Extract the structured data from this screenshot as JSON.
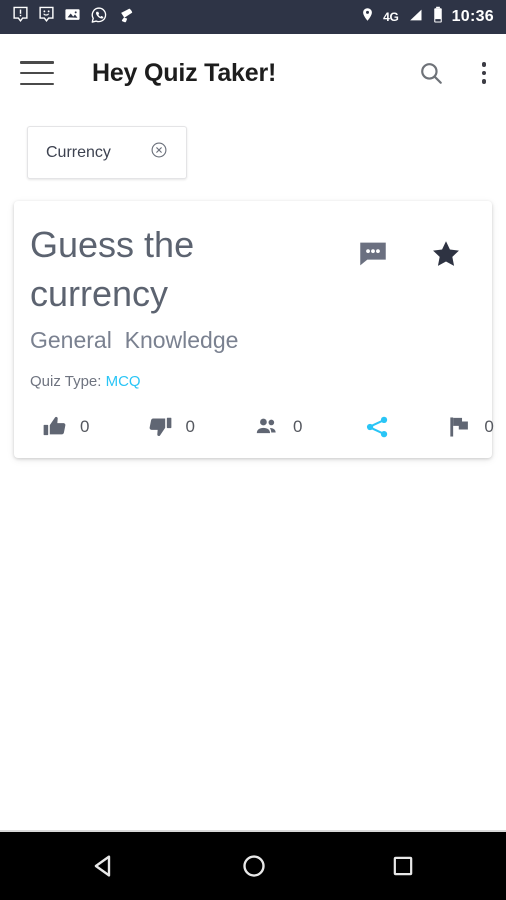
{
  "statusbar": {
    "notifications": [
      {
        "name": "alert-notification-icon"
      },
      {
        "name": "smiley-notification-icon"
      },
      {
        "name": "photo-notification-icon"
      },
      {
        "name": "whatsapp-notification-icon"
      },
      {
        "name": "cleaner-notification-icon"
      }
    ],
    "location_icon": "location-pin-icon",
    "network": "4G",
    "signal_icon": "signal-bars-icon",
    "battery_icon": "battery-icon",
    "time": "10:36",
    "background": "#2e3446"
  },
  "appbar": {
    "menu_icon": "hamburger-menu-icon",
    "title": "Hey Quiz Taker!",
    "search_icon": "search-icon",
    "overflow_icon": "more-vertical-icon"
  },
  "filter": {
    "chip_label": "Currency",
    "clear_icon": "close-circle-icon"
  },
  "quiz_card": {
    "title": "Guess the currency",
    "category": "General  Knowledge",
    "comment_icon": "comment-bubble-icon",
    "favorite_icon": "star-filled-icon",
    "quiz_type_label": "Quiz Type:",
    "quiz_type_value": "MCQ",
    "quiz_type_color": "#29c5f6",
    "stats": {
      "like_icon": "thumbs-up-icon",
      "like_count": "0",
      "dislike_icon": "thumbs-down-icon",
      "dislike_count": "0",
      "players_icon": "people-icon",
      "players_count": "0",
      "share_icon": "share-icon",
      "share_color": "#29c5f6",
      "flag_icon": "flag-icon",
      "flag_count": "0"
    }
  },
  "navbar": {
    "back_icon": "back-triangle-icon",
    "home_icon": "home-circle-icon",
    "recents_icon": "recents-square-icon"
  }
}
